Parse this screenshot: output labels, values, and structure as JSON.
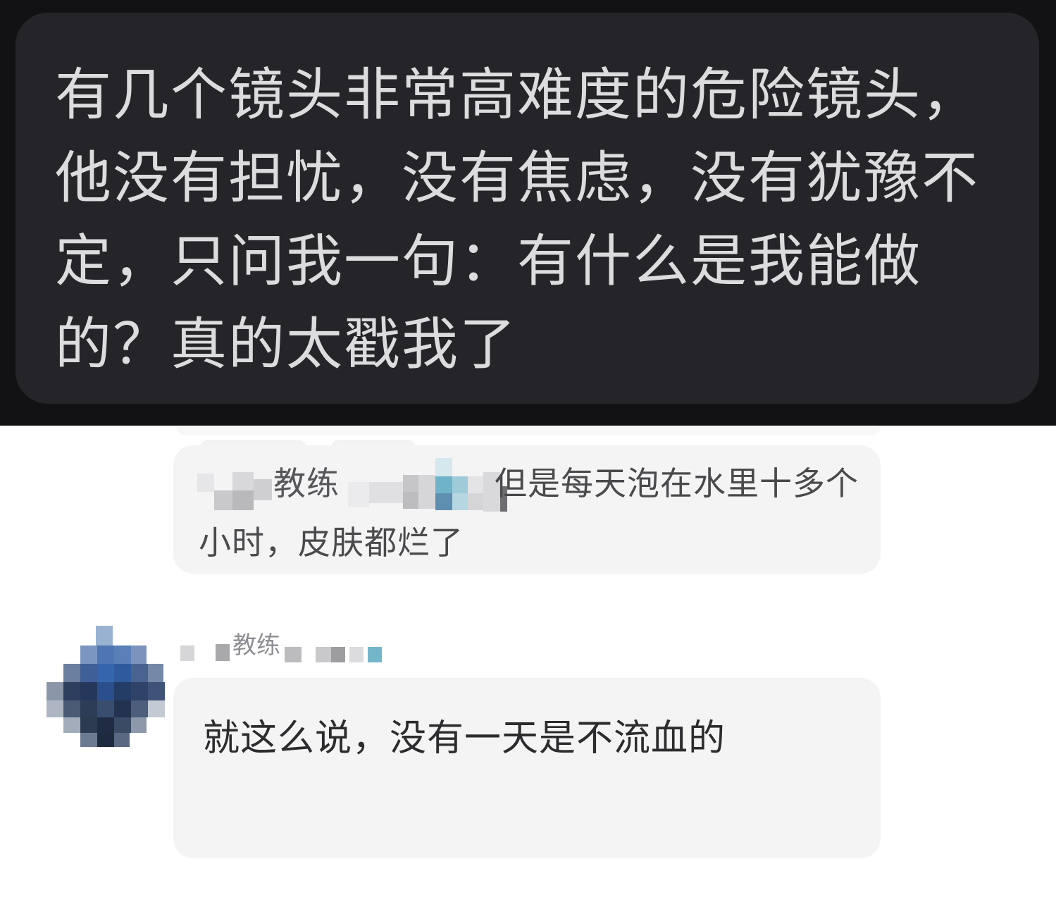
{
  "post": {
    "text": "有几个镜头非常高难度的危险镜头，他没有担忧，没有焦虑，没有犹豫不定，只问我一句：有什么是我能做的？真的太戳我了"
  },
  "reply": {
    "redacted_name": "教练",
    "text_visible": "但是每天泡在水里十",
    "text_line2": "多个小时，皮肤都烂了"
  },
  "comment": {
    "username": "教练",
    "text": "就这么说，没有一天是不流血的"
  },
  "colors": {
    "dark_bg": "#121214",
    "dark_bubble": "#252529",
    "dark_text": "#dcdcde",
    "light_bubble": "#f4f4f5",
    "light_text": "#2c2c2e"
  }
}
